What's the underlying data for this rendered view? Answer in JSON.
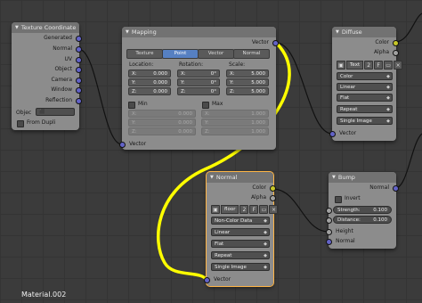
{
  "texture_coordinate": {
    "title": "Texture Coordinate",
    "outputs": [
      "Generated",
      "Normal",
      "UV",
      "Object",
      "Camera",
      "Window",
      "Reflection"
    ],
    "object_label": "Objec",
    "from_dupli": "From Dupli"
  },
  "mapping": {
    "title": "Mapping",
    "output": "Vector",
    "input": "Vector",
    "tabs": [
      "Texture",
      "Point",
      "Vector",
      "Normal"
    ],
    "active_tab": "Point",
    "location_label": "Location:",
    "rotation_label": "Rotation:",
    "scale_label": "Scale:",
    "location": [
      {
        "axis": "X:",
        "value": "0.000"
      },
      {
        "axis": "Y:",
        "value": "0.000"
      },
      {
        "axis": "Z:",
        "value": "0.000"
      }
    ],
    "rotation": [
      {
        "axis": "X:",
        "value": "0°"
      },
      {
        "axis": "Y:",
        "value": "0°"
      },
      {
        "axis": "Z:",
        "value": "0°"
      }
    ],
    "scale": [
      {
        "axis": "X:",
        "value": "5.000"
      },
      {
        "axis": "Y:",
        "value": "5.000"
      },
      {
        "axis": "Z:",
        "value": "5.000"
      }
    ],
    "min_label": "Min",
    "max_label": "Max",
    "min": [
      {
        "axis": "X:",
        "value": "0.000"
      },
      {
        "axis": "Y:",
        "value": "0.000"
      },
      {
        "axis": "Z:",
        "value": "0.000"
      }
    ],
    "max": [
      {
        "axis": "X:",
        "value": "1.000"
      },
      {
        "axis": "Y:",
        "value": "1.000"
      },
      {
        "axis": "Z:",
        "value": "1.000"
      }
    ]
  },
  "diffuse": {
    "title": "Diffuse",
    "outputs": [
      "Color",
      "Alpha"
    ],
    "image_name": "Text",
    "users": "2",
    "fake": "F",
    "color_mode": "Color",
    "interpolation": "Linear",
    "projection": "Flat",
    "extension": "Repeat",
    "source": "Single Image",
    "input": "Vector"
  },
  "normal": {
    "title": "Normal",
    "outputs": [
      "Color",
      "Alpha"
    ],
    "image_name": "floor",
    "users": "2",
    "fake": "F",
    "color_mode": "Non-Color Data",
    "interpolation": "Linear",
    "projection": "Flat",
    "extension": "Repeat",
    "source": "Single Image",
    "input": "Vector"
  },
  "bump": {
    "title": "Bump",
    "output": "Normal",
    "invert": "Invert",
    "strength_label": "Strength:",
    "strength": "0.100",
    "distance_label": "Distance:",
    "distance": "0.100",
    "height": "Height",
    "normal_in": "Normal"
  },
  "material_name": "Material.002",
  "colors": {
    "node_body": "#8c8c8c",
    "node_header": "#727272",
    "vector_socket": "#6363c7",
    "color_socket": "#c7c729",
    "gray_socket": "#a1a1a1",
    "active_tab": "#5680c2",
    "highlight_stroke": "#ffff00",
    "active_outline": "#ffb545"
  }
}
